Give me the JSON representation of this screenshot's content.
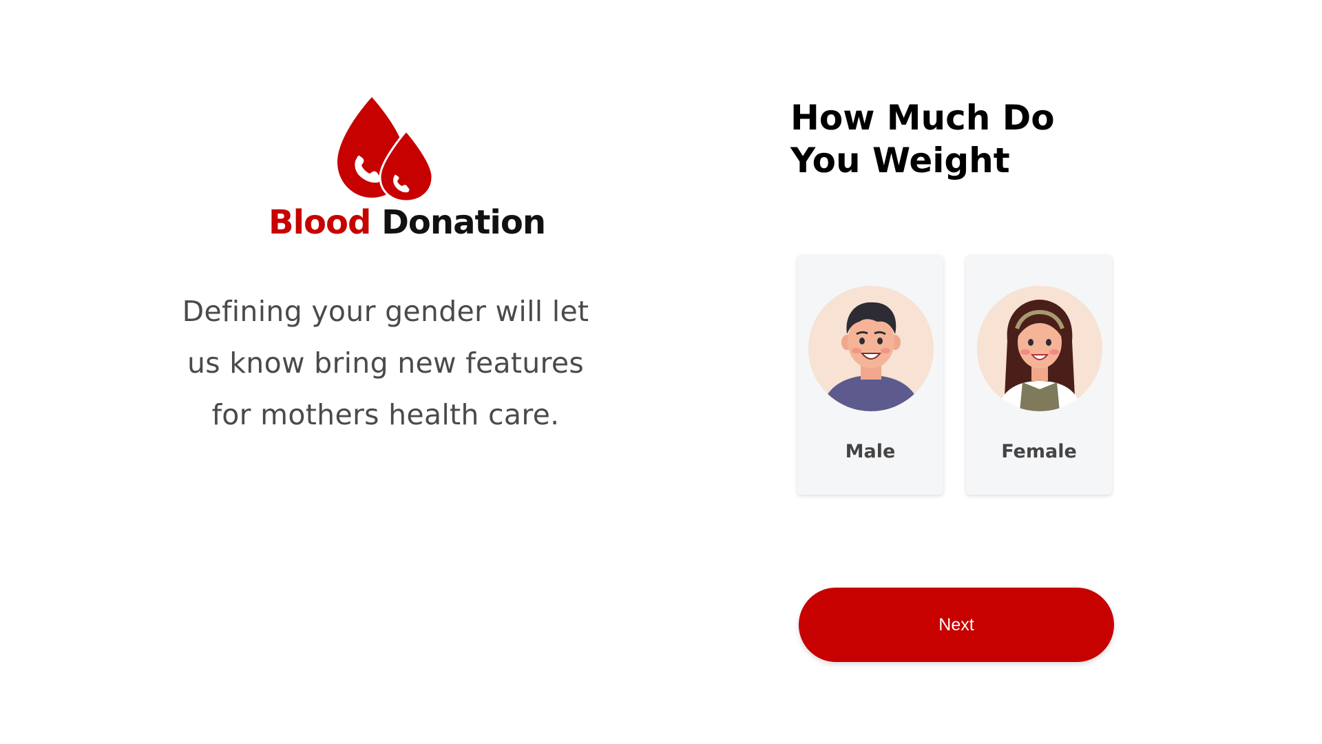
{
  "brand": {
    "name_part1": "Blood",
    "name_part2": "Donation",
    "logo_icon": "blood-drops-phone-icon",
    "accent_color": "#c70000"
  },
  "intro": {
    "line1": "Defining your gender will let",
    "line2": "us know bring new features",
    "line3": "for mothers health care."
  },
  "question": {
    "line1": "How Much Do",
    "line2": "You Weight"
  },
  "gender_options": [
    {
      "label": "Male",
      "icon": "male-avatar-icon"
    },
    {
      "label": "Female",
      "icon": "female-avatar-icon"
    }
  ],
  "next_button": {
    "label": "Next"
  }
}
